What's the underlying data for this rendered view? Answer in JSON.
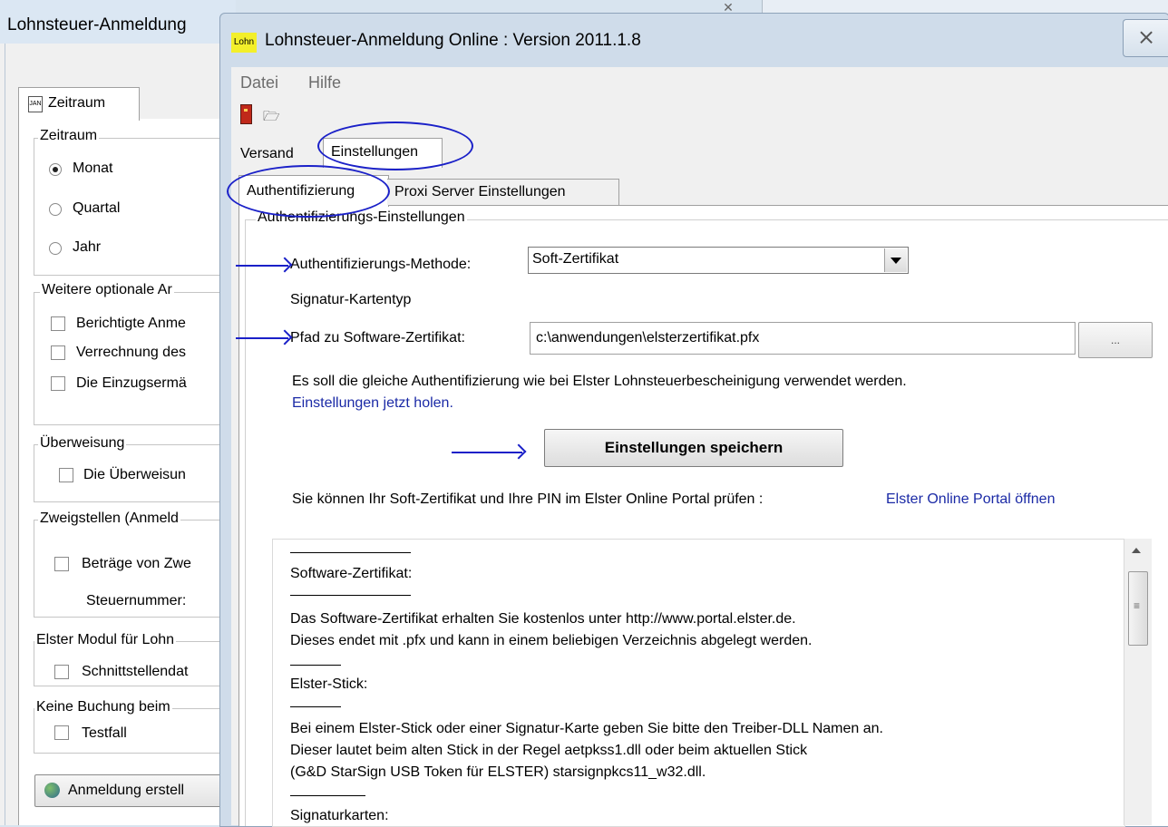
{
  "background_window": {
    "title": "Lohnsteuer-Anmeldung",
    "tab_label": "Zeitraum",
    "zeitraum_legend": "Zeitraum",
    "radios": [
      "Monat",
      "Quartal",
      "Jahr"
    ],
    "optional_legend": "Weitere optionale Ar",
    "optional_items": [
      "Berichtigte Anme",
      "Verrechnung des",
      "Die Einzugsermä"
    ],
    "ueberweisung_legend": "Überweisung",
    "ueberweisung_item": "Die Überweisun",
    "zweig_legend": "Zweigstellen (Anmeld",
    "zweig_item": "Beträge von Zwe",
    "steuernummer_label": "Steuernummer:",
    "elster_legend": "Elster Modul für Lohn",
    "elster_item": "Schnittstellendat",
    "keine_legend": "Keine Buchung beim",
    "keine_item": "Testfall",
    "create_button": "Anmeldung erstell"
  },
  "dialog": {
    "logo_text": "Lohn",
    "title": "Lohnsteuer-Anmeldung Online : Version 2011.1.8",
    "close_glyph": "⨯",
    "menu": [
      "Datei",
      "Hilfe"
    ],
    "tabs_top": [
      "Versand",
      "Einstellungen"
    ],
    "tabs_sub": [
      "Authentifizierung",
      "Proxi Server Einstellungen"
    ],
    "group_legend": "Authentifizierungs-Einstellungen",
    "method_label": "Authentifizierungs-Methode:",
    "method_value": "Soft-Zertifikat",
    "kartentyp_label": "Signatur-Kartentyp",
    "path_label": "Pfad zu Software-Zertifikat:",
    "path_value": "c:\\anwendungen\\elsterzertifikat.pfx",
    "browse_label": "...",
    "same_auth_text": "Es soll die gleiche Authentifizierung wie bei Elster Lohnsteuerbescheinigung verwendet werden.",
    "holen_link": "Einstellungen jetzt holen.",
    "save_button": "Einstellungen speichern",
    "portal_text": "Sie können Ihr Soft-Zertifikat und Ihre PIN im Elster Online Portal prüfen :",
    "portal_link": "Elster Online Portal öffnen",
    "info_lines": [
      "Software-Zertifikat:",
      "Das Software-Zertifikat erhalten Sie kostenlos unter http://www.portal.elster.de.",
      "Dieses endet mit .pfx und kann in einem beliebigen Verzeichnis abgelegt werden.",
      "Elster-Stick:",
      "Bei einem Elster-Stick oder einer Signatur-Karte geben Sie bitte den Treiber-DLL Namen an.",
      "Dieser lautet beim alten Stick in der Regel aetpkss1.dll oder beim aktuellen Stick",
      "(G&D StarSign USB Token für ELSTER) starsignpkcs11_w32.dll.",
      "Signaturkarten:"
    ]
  },
  "colors": {
    "annotation": "#1a20c8",
    "link": "#1b2aa6",
    "logo_bg": "#f3ef2a"
  }
}
